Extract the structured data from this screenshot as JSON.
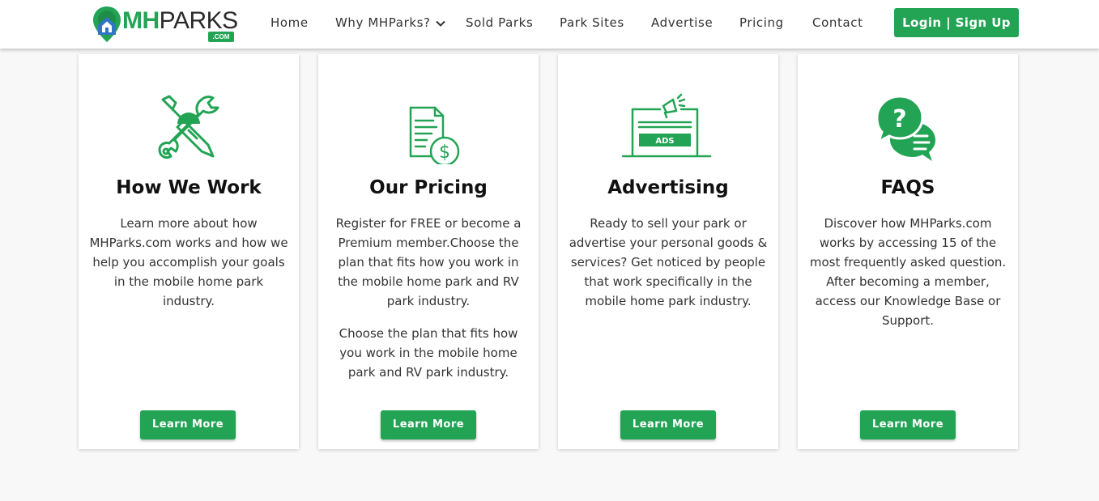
{
  "brand": {
    "mh": "MH",
    "parks": "PARKS",
    "com": ".COM",
    "accent": "#23a455"
  },
  "nav": {
    "items": [
      {
        "label": "Home"
      },
      {
        "label": "Why MHParks?"
      },
      {
        "label": "Sold Parks"
      },
      {
        "label": "Park Sites"
      },
      {
        "label": "Advertise"
      },
      {
        "label": "Pricing"
      },
      {
        "label": "Contact"
      }
    ],
    "login_label": "Login | Sign Up"
  },
  "cards": [
    {
      "icon": "tools-icon",
      "title": "How We Work",
      "paragraphs": [
        "Learn more about how MHParks.com works and how we help you accomplish your goals in the mobile home park industry."
      ],
      "button": "Learn More"
    },
    {
      "icon": "pricing-document-icon",
      "title": "Our Pricing",
      "paragraphs": [
        "Register for FREE or become a Premium member.Choose the plan that fits how you work in the mobile home park and RV park industry.",
        "Choose the plan that fits how you work in the mobile home park and RV park industry."
      ],
      "button": "Learn More"
    },
    {
      "icon": "ads-laptop-icon",
      "title": "Advertising",
      "ads_label": "ADS",
      "paragraphs": [
        "Ready to sell your park or advertise your personal goods & services? Get noticed by people that work specifically in the mobile home park industry."
      ],
      "button": "Learn More"
    },
    {
      "icon": "faq-chat-icon",
      "title": "FAQS",
      "paragraphs": [
        "Discover how MHParks.com works by accessing 15 of the most frequently asked question. After becoming a member, access our Knowledge Base or Support."
      ],
      "button": "Learn More"
    }
  ]
}
